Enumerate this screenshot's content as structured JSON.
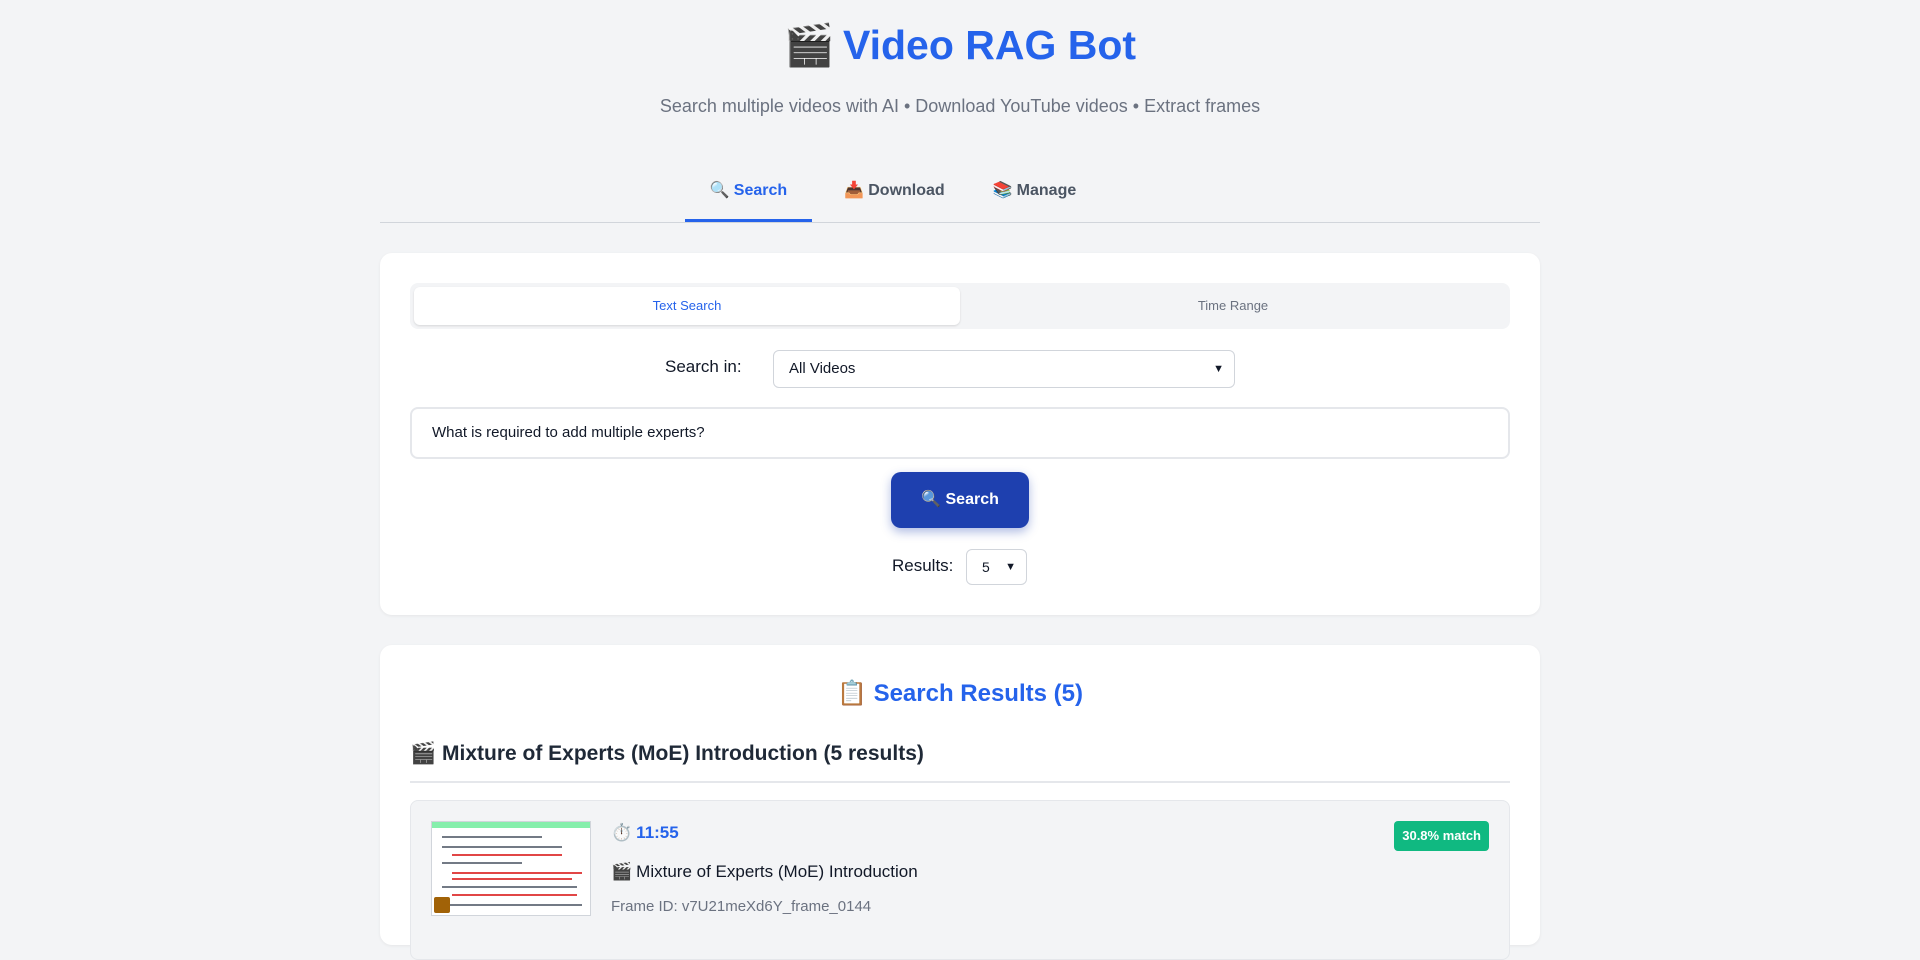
{
  "header": {
    "title_icon": "🎬",
    "title": "Video RAG Bot",
    "subtitle": "Search multiple videos with AI • Download YouTube videos • Extract frames"
  },
  "tabs": [
    {
      "icon": "🔍",
      "icon_name": "magnifier-icon",
      "label": "Search",
      "active": true
    },
    {
      "icon": "📥",
      "icon_name": "inbox-tray-icon",
      "label": "Download",
      "active": false
    },
    {
      "icon": "📚",
      "icon_name": "books-icon",
      "label": "Manage",
      "active": false
    }
  ],
  "search_panel": {
    "modes": [
      {
        "label": "Text Search",
        "active": true
      },
      {
        "label": "Time Range",
        "active": false
      }
    ],
    "search_in_label": "Search in:",
    "search_in_value": "All Videos",
    "query_value": "What is required to add multiple experts?",
    "search_button": {
      "icon": "🔍",
      "label": "Search"
    },
    "results_label": "Results:",
    "results_value": "5"
  },
  "results": {
    "title_icon": "📋",
    "title": "Search Results (5)",
    "video_group_icon": "🎬",
    "video_group_title": "Mixture of Experts (MoE) Introduction (5 results)",
    "items": [
      {
        "timestamp_icon": "⏱️",
        "timestamp": "11:55",
        "match": "30.8% match",
        "video_icon": "🎬",
        "video_title": "Mixture of Experts (MoE) Introduction",
        "frame_id": "Frame ID: v7U21meXd6Y_frame_0144"
      }
    ]
  },
  "colors": {
    "accent": "#2563eb",
    "button": "#1e40af",
    "match_badge": "#10b981",
    "background": "#f3f4f6"
  }
}
